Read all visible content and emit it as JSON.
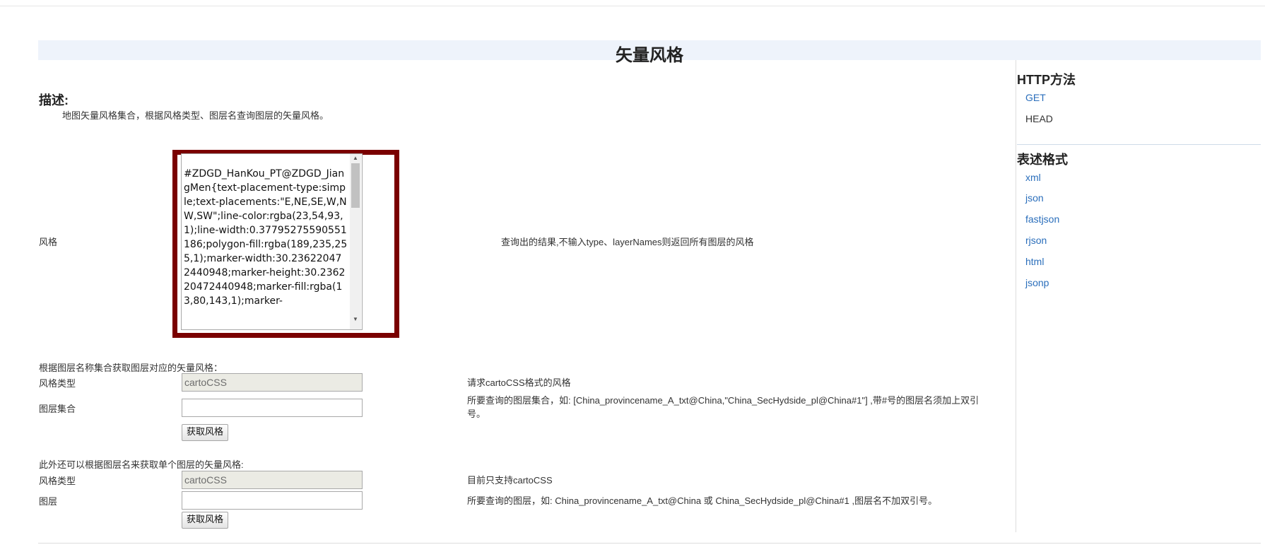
{
  "page": {
    "title": "矢量风格"
  },
  "description": {
    "heading": "描述:",
    "text": "地图矢量风格集合，根据风格类型、图层名查询图层的矢量风格。"
  },
  "style_result": {
    "label": "风格",
    "value": "#ZDGD_HanKou_PT@ZDGD_JiangMen{text-placement-type:simple;text-placements:\"E,NE,SE,W,NW,SW\";line-color:rgba(23,54,93,1);line-width:0.37795275590551186;polygon-fill:rgba(189,235,255,1);marker-width:30.236220472440948;marker-height:30.236220472440948;marker-fill:rgba(13,80,143,1);marker-",
    "description": "查询出的结果,不输入type、layerNames则返回所有图层的风格"
  },
  "form_layers": {
    "intro": "根据图层名称集合获取图层对应的矢量风格：",
    "style_type_label": "风格类型",
    "style_type_value": "cartoCSS",
    "style_type_desc": "请求cartoCSS格式的风格",
    "layers_label": "图层集合",
    "layers_value": "",
    "layers_desc": "所要查询的图层集合，如: [China_provincename_A_txt@China,\"China_SecHydside_pl@China#1\"] ,带#号的图层名须加上双引号。",
    "submit_label": "获取风格"
  },
  "form_single": {
    "intro": "此外还可以根据图层名来获取单个图层的矢量风格:",
    "style_type_label": "风格类型",
    "style_type_value": "cartoCSS",
    "style_type_desc": "目前只支持cartoCSS",
    "layer_label": "图层",
    "layer_value": "",
    "layer_desc": "所要查询的图层，如: China_provincename_A_txt@China 或 China_SecHydside_pl@China#1 ,图层名不加双引号。",
    "submit_label": "获取风格"
  },
  "sidebar": {
    "http_heading": "HTTP方法",
    "http_methods": [
      {
        "label": "GET",
        "link": true
      },
      {
        "label": "HEAD",
        "link": false
      }
    ],
    "format_heading": "表述格式",
    "formats": [
      "xml",
      "json",
      "fastjson",
      "rjson",
      "html",
      "jsonp"
    ]
  },
  "colors": {
    "highlight_border": "#7a0000",
    "link": "#2a6ebb",
    "title_bar": "#eef3fb"
  }
}
